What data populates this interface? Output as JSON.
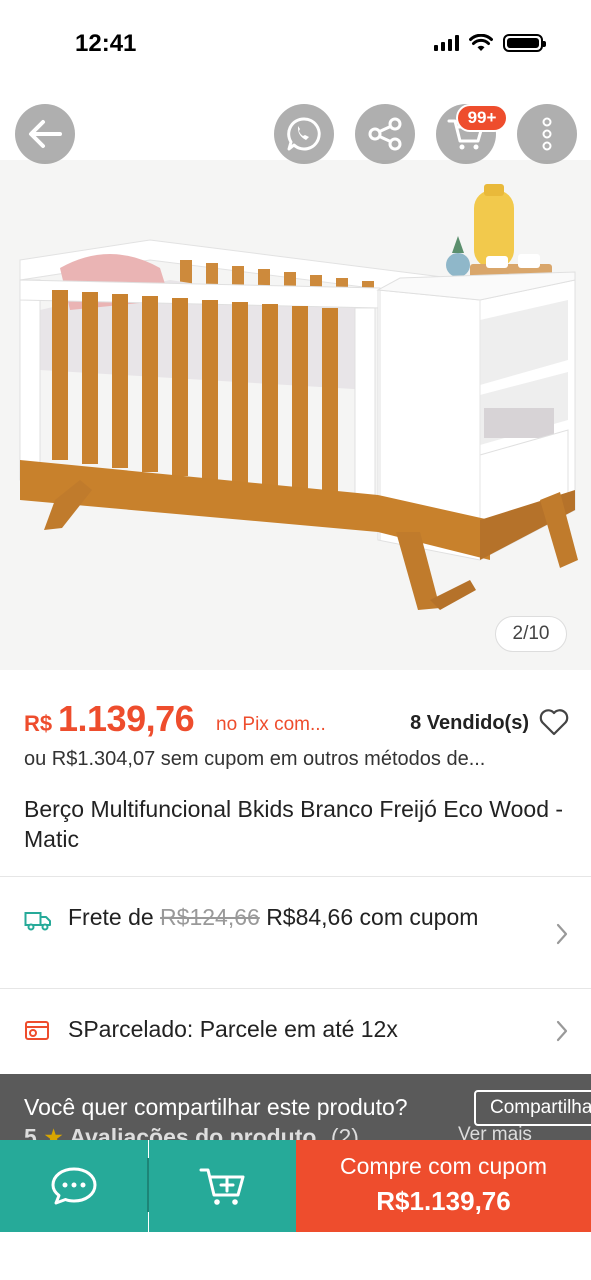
{
  "status_bar": {
    "time": "12:41"
  },
  "header_buttons": {
    "back_icon": "arrow-left-icon",
    "whatsapp_icon": "whatsapp-icon",
    "share_icon": "share-icon",
    "cart_icon": "cart-icon",
    "cart_badge": "99+",
    "more_icon": "more-vertical-icon"
  },
  "gallery": {
    "counter": "2/10"
  },
  "product": {
    "currency": "R$",
    "price": "1.139,76",
    "price_note": "no Pix com...",
    "sold": "8 Vendido(s)",
    "other_price": "ou R$1.304,07 sem cupom em outros métodos de...",
    "title": "Berço Multifuncional Bkids Branco Freijó Eco Wood - Matic"
  },
  "shipping": {
    "prefix": "Frete de",
    "old_price": "R$124,66",
    "new_price": "R$84,66 com cupom"
  },
  "installments": {
    "label": "SParcelado: Parcele em até 12x"
  },
  "share_banner": {
    "text": "Você quer compartilhar este produto?",
    "button": "Compartilhar"
  },
  "reviews_peek": {
    "rating": "5",
    "label": "Avaliações do produto",
    "count": "(2)",
    "more": "Ver mais"
  },
  "bottom_bar": {
    "buy_label": "Compre com cupom",
    "buy_price": "R$1.139,76"
  },
  "colors": {
    "accent": "#ee4d2d",
    "teal": "#26aa99"
  }
}
